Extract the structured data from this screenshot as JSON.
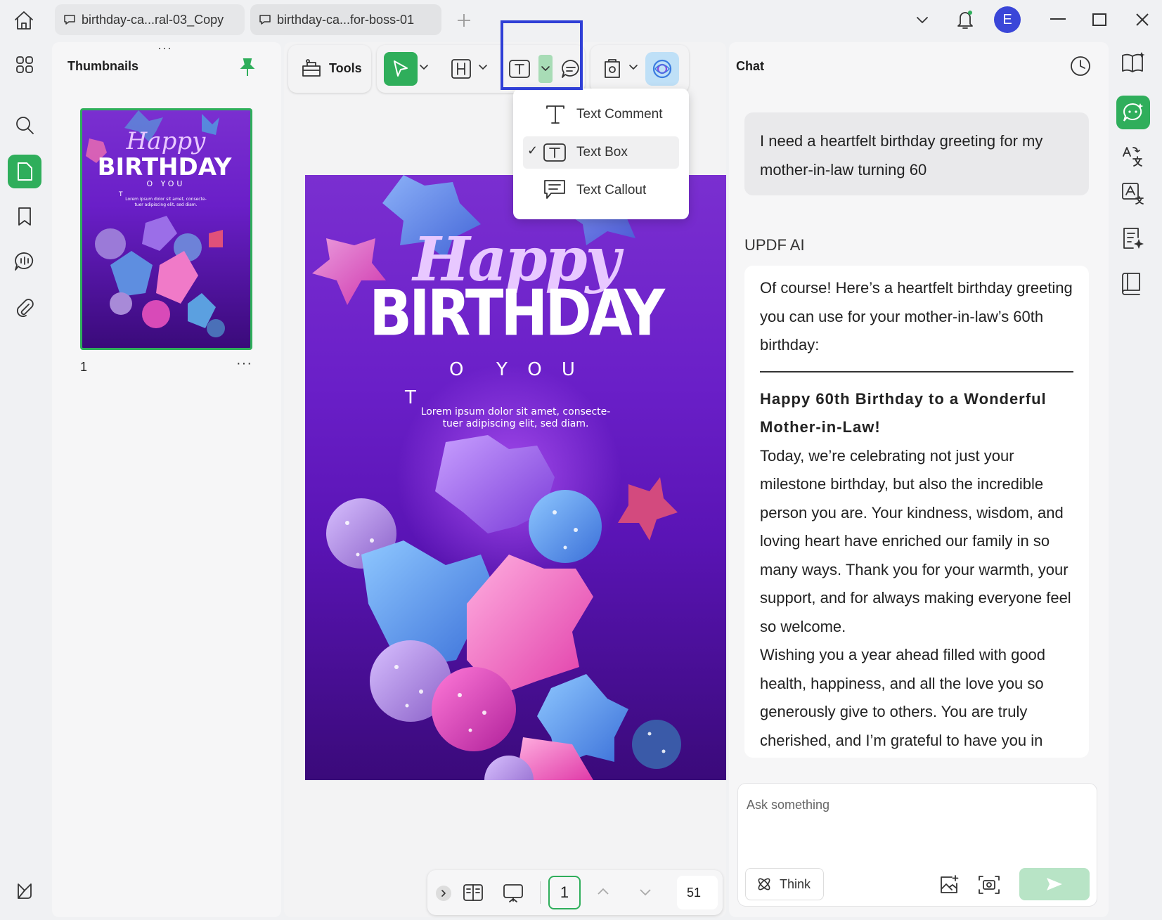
{
  "titlebar": {
    "tabs": [
      {
        "label": "birthday-ca...ral-03_Copy",
        "active": false
      },
      {
        "label": "birthday-ca...for-boss-01",
        "active": true
      }
    ],
    "avatar_letter": "E"
  },
  "thumbnails": {
    "title": "Thumbnails",
    "page_number": "1",
    "more": "···"
  },
  "toolbar": {
    "tools_label": "Tools"
  },
  "text_menu": {
    "items": [
      {
        "label": "Text Comment",
        "checked": false
      },
      {
        "label": "Text Box",
        "checked": true
      },
      {
        "label": "Text Callout",
        "checked": false
      }
    ]
  },
  "card": {
    "happy": "Happy",
    "birthday": "BIRTHDAY",
    "to_you": "O  Y O U",
    "t_marker": "T",
    "lorem1": "Lorem ipsum dolor sit amet, consecte-",
    "lorem2": "tuer adipiscing elit, sed diam."
  },
  "bottombar": {
    "page_input": "1",
    "zoom": "51"
  },
  "chat": {
    "title": "Chat",
    "user_message": "I need a heartfelt birthday greeting for my mother-in-law turning 60",
    "ai_label": "UPDF AI",
    "ai_intro": "Of course! Here’s a heartfelt birthday greeting you can use for your mother-in-law’s 60th birthday:",
    "ai_heading": "Happy 60th Birthday to a Wonderful Mother-in-Law!",
    "ai_para1": "Today, we’re celebrating not just your milestone birthday, but also the incredible person you are. Your kindness, wisdom, and loving heart have enriched our family in so many ways. Thank you for your warmth, your support, and for always making everyone feel so welcome.",
    "ai_para2": "Wishing you a year ahead filled with good health, happiness, and all the love you so generously give to others. You are truly cherished, and I’m grateful to have you in",
    "input_placeholder": "Ask something",
    "think_label": "Think"
  },
  "colors": {
    "accent_green": "#2fae5b",
    "highlight_blue": "#2f3fd6",
    "card_purple": "#6a1fc8"
  }
}
